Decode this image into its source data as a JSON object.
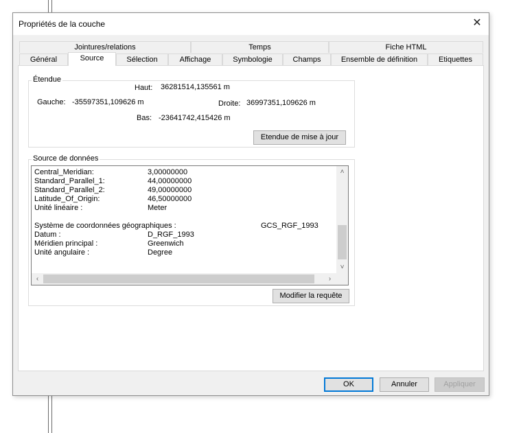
{
  "window": {
    "title": "Propriétés de la couche",
    "close_symbol": "✕"
  },
  "tabs": {
    "row1": [
      "Jointures/relations",
      "Temps",
      "Fiche HTML"
    ],
    "row2": [
      "Général",
      "Source",
      "Sélection",
      "Affichage",
      "Symbologie",
      "Champs",
      "Ensemble de définition",
      "Etiquettes"
    ],
    "active": "Source"
  },
  "extent": {
    "legend": "Étendue",
    "haut_label": "Haut:",
    "haut_value": "36281514,135561 m",
    "gauche_label": "Gauche:",
    "gauche_value": "-35597351,109626 m",
    "droite_label": "Droite:",
    "droite_value": "36997351,109626 m",
    "bas_label": "Bas:",
    "bas_value": "-23641742,415426 m",
    "update_button": "Etendue de mise à jour"
  },
  "datasource": {
    "legend": "Source de données",
    "rows": [
      {
        "k": "Central_Meridian:",
        "v": "3,00000000"
      },
      {
        "k": "Standard_Parallel_1:",
        "v": "44,00000000"
      },
      {
        "k": "Standard_Parallel_2:",
        "v": "49,00000000"
      },
      {
        "k": "Latitude_Of_Origin:",
        "v": "46,50000000"
      },
      {
        "k": "Unité linéaire :",
        "v": "Meter"
      },
      {
        "k": "",
        "v": ""
      },
      {
        "k": "Système de coordonnées géographiques :",
        "v": "GCS_RGF_1993"
      },
      {
        "k": "Datum :",
        "v": "D_RGF_1993"
      },
      {
        "k": "Méridien principal :",
        "v": "Greenwich"
      },
      {
        "k": "Unité angulaire :",
        "v": "Degree"
      }
    ],
    "modify_button": "Modifier la requête"
  },
  "footer": {
    "ok": "OK",
    "cancel": "Annuler",
    "apply": "Appliquer"
  }
}
